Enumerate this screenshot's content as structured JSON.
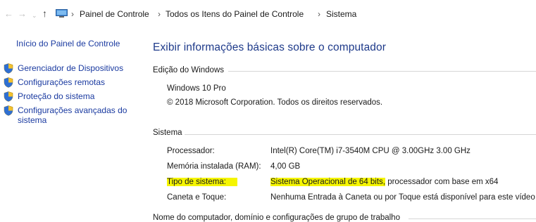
{
  "address_bar": {
    "back_glyph": "←",
    "forward_glyph": "→",
    "dropdown_glyph": "⌄",
    "up_glyph": "↑",
    "location_icon": "computer-icon",
    "separator": "›",
    "crumbs": [
      "Painel de Controle",
      "Todos os Itens do Painel de Controle",
      "Sistema"
    ]
  },
  "sidebar": {
    "home_link": "Início do Painel de Controle",
    "items": [
      {
        "icon": "shield-icon",
        "label": "Gerenciador de Dispositivos"
      },
      {
        "icon": "shield-icon",
        "label": "Configurações remotas"
      },
      {
        "icon": "shield-icon",
        "label": "Proteção do sistema"
      },
      {
        "icon": "shield-icon",
        "label_line1": "Configurações avançadas do",
        "label_line2": "sistema"
      }
    ]
  },
  "main": {
    "title": "Exibir informações básicas sobre o computador",
    "windows_edition": {
      "heading": "Edição do Windows",
      "edition": "Windows 10 Pro",
      "copyright": "© 2018 Microsoft Corporation. Todos os direitos reservados."
    },
    "system": {
      "heading": "Sistema",
      "processor_label": "Processador:",
      "processor_value": "Intel(R) Core(TM) i7-3540M CPU @ 3.00GHz   3.00 GHz",
      "ram_label": "Memória instalada (RAM):",
      "ram_value": "4,00 GB",
      "type_label": "Tipo de sistema:",
      "type_value_highlight": "Sistema Operacional de 64 bits,",
      "type_value_rest": " processador com base em x64",
      "pen_label": "Caneta e Toque:",
      "pen_value": "Nenhuma Entrada à Caneta ou por Toque está disponível para este vídeo"
    },
    "computer_name": {
      "heading": "Nome do computador, domínio e configurações de grupo de trabalho"
    }
  },
  "colors": {
    "link": "#1a3aa0",
    "title": "#1e3a8a",
    "highlight": "#f5f500"
  }
}
